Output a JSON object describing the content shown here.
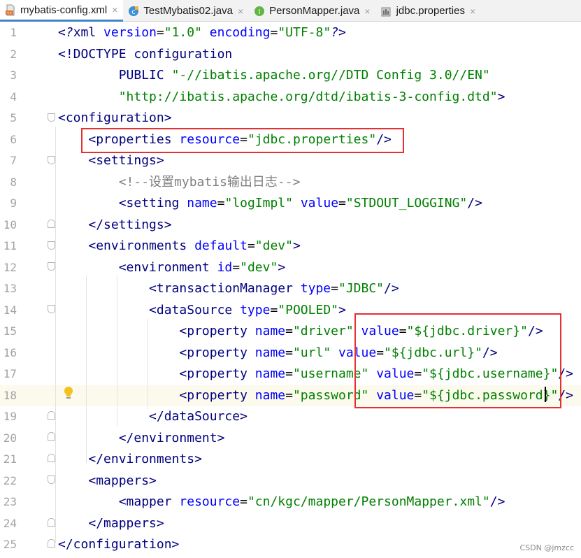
{
  "tabs": [
    {
      "label": "mybatis-config.xml",
      "icon": "xml-file-icon",
      "active": true
    },
    {
      "label": "TestMybatis02.java",
      "icon": "java-class-icon",
      "active": false
    },
    {
      "label": "PersonMapper.java",
      "icon": "java-interface-icon",
      "active": false
    },
    {
      "label": "jdbc.properties",
      "icon": "properties-file-icon",
      "active": false
    }
  ],
  "close_glyph": "×",
  "lines": [
    {
      "n": "1",
      "tokens": [
        [
          "prolog",
          "<?"
        ],
        [
          "tag",
          "xml "
        ],
        [
          "attr",
          "version"
        ],
        [
          "plain",
          "="
        ],
        [
          "str",
          "\"1.0\""
        ],
        [
          "plain",
          " "
        ],
        [
          "attr",
          "encoding"
        ],
        [
          "plain",
          "="
        ],
        [
          "str",
          "\"UTF-8\""
        ],
        [
          "prolog",
          "?>"
        ]
      ]
    },
    {
      "n": "2",
      "tokens": [
        [
          "dt",
          "<!DOCTYPE configuration"
        ]
      ]
    },
    {
      "n": "3",
      "tokens": [
        [
          "plain",
          "        "
        ],
        [
          "dt",
          "PUBLIC "
        ],
        [
          "str",
          "\"-//ibatis.apache.org//DTD Config 3.0//EN\""
        ]
      ]
    },
    {
      "n": "4",
      "tokens": [
        [
          "plain",
          "        "
        ],
        [
          "str",
          "\"http://ibatis.apache.org/dtd/ibatis-3-config.dtd\""
        ],
        [
          "dt",
          ">"
        ]
      ]
    },
    {
      "n": "5",
      "tokens": [
        [
          "tag",
          "<configuration>"
        ]
      ]
    },
    {
      "n": "6",
      "tokens": [
        [
          "plain",
          "    "
        ],
        [
          "tag",
          "<properties "
        ],
        [
          "attr",
          "resource"
        ],
        [
          "plain",
          "="
        ],
        [
          "str",
          "\"jdbc.properties\""
        ],
        [
          "tag",
          "/>"
        ]
      ]
    },
    {
      "n": "7",
      "tokens": [
        [
          "plain",
          "    "
        ],
        [
          "tag",
          "<settings>"
        ]
      ]
    },
    {
      "n": "8",
      "tokens": [
        [
          "plain",
          "        "
        ],
        [
          "cmt",
          "<!--设置mybatis输出日志-->"
        ]
      ]
    },
    {
      "n": "9",
      "tokens": [
        [
          "plain",
          "        "
        ],
        [
          "tag",
          "<setting "
        ],
        [
          "attr",
          "name"
        ],
        [
          "plain",
          "="
        ],
        [
          "str",
          "\"logImpl\""
        ],
        [
          "plain",
          " "
        ],
        [
          "attr",
          "value"
        ],
        [
          "plain",
          "="
        ],
        [
          "str",
          "\"STDOUT_LOGGING\""
        ],
        [
          "tag",
          "/>"
        ]
      ]
    },
    {
      "n": "10",
      "tokens": [
        [
          "plain",
          "    "
        ],
        [
          "tag",
          "</settings>"
        ]
      ]
    },
    {
      "n": "11",
      "tokens": [
        [
          "plain",
          "    "
        ],
        [
          "tag",
          "<environments "
        ],
        [
          "attr",
          "default"
        ],
        [
          "plain",
          "="
        ],
        [
          "str",
          "\"dev\""
        ],
        [
          "tag",
          ">"
        ]
      ]
    },
    {
      "n": "12",
      "tokens": [
        [
          "plain",
          "        "
        ],
        [
          "tag",
          "<environment "
        ],
        [
          "attr",
          "id"
        ],
        [
          "plain",
          "="
        ],
        [
          "str",
          "\"dev\""
        ],
        [
          "tag",
          ">"
        ]
      ]
    },
    {
      "n": "13",
      "tokens": [
        [
          "plain",
          "            "
        ],
        [
          "tag",
          "<transactionManager "
        ],
        [
          "attr",
          "type"
        ],
        [
          "plain",
          "="
        ],
        [
          "str",
          "\"JDBC\""
        ],
        [
          "tag",
          "/>"
        ]
      ]
    },
    {
      "n": "14",
      "tokens": [
        [
          "plain",
          "            "
        ],
        [
          "tag",
          "<dataSource "
        ],
        [
          "attr",
          "type"
        ],
        [
          "plain",
          "="
        ],
        [
          "str",
          "\"POOLED\""
        ],
        [
          "tag",
          ">"
        ]
      ]
    },
    {
      "n": "15",
      "tokens": [
        [
          "plain",
          "                "
        ],
        [
          "tag",
          "<property "
        ],
        [
          "attr",
          "name"
        ],
        [
          "plain",
          "="
        ],
        [
          "str",
          "\"driver\""
        ],
        [
          "plain",
          " "
        ],
        [
          "attr",
          "value"
        ],
        [
          "plain",
          "="
        ],
        [
          "str",
          "\"${jdbc.driver}\""
        ],
        [
          "tag",
          "/>"
        ]
      ]
    },
    {
      "n": "16",
      "tokens": [
        [
          "plain",
          "                "
        ],
        [
          "tag",
          "<property "
        ],
        [
          "attr",
          "name"
        ],
        [
          "plain",
          "="
        ],
        [
          "str",
          "\"url\""
        ],
        [
          "plain",
          " "
        ],
        [
          "attr",
          "value"
        ],
        [
          "plain",
          "="
        ],
        [
          "str",
          "\"${jdbc.url}\""
        ],
        [
          "tag",
          "/>"
        ]
      ]
    },
    {
      "n": "17",
      "tokens": [
        [
          "plain",
          "                "
        ],
        [
          "tag",
          "<property "
        ],
        [
          "attr",
          "name"
        ],
        [
          "plain",
          "="
        ],
        [
          "str",
          "\"username\""
        ],
        [
          "plain",
          " "
        ],
        [
          "attr",
          "value"
        ],
        [
          "plain",
          "="
        ],
        [
          "str",
          "\"${jdbc.username}\""
        ],
        [
          "tag",
          "/>"
        ]
      ]
    },
    {
      "n": "18",
      "tokens": [
        [
          "plain",
          "                "
        ],
        [
          "tag",
          "<property "
        ],
        [
          "attr",
          "name"
        ],
        [
          "plain",
          "="
        ],
        [
          "str",
          "\"password\""
        ],
        [
          "plain",
          " "
        ],
        [
          "attr",
          "value"
        ],
        [
          "plain",
          "="
        ],
        [
          "str",
          "\"${jdbc.password}\""
        ],
        [
          "tag",
          "/>"
        ]
      ]
    },
    {
      "n": "19",
      "tokens": [
        [
          "plain",
          "            "
        ],
        [
          "tag",
          "</dataSource>"
        ]
      ]
    },
    {
      "n": "20",
      "tokens": [
        [
          "plain",
          "        "
        ],
        [
          "tag",
          "</environment>"
        ]
      ]
    },
    {
      "n": "21",
      "tokens": [
        [
          "plain",
          "    "
        ],
        [
          "tag",
          "</environments>"
        ]
      ]
    },
    {
      "n": "22",
      "tokens": [
        [
          "plain",
          "    "
        ],
        [
          "tag",
          "<mappers>"
        ]
      ]
    },
    {
      "n": "23",
      "tokens": [
        [
          "plain",
          "        "
        ],
        [
          "tag",
          "<mapper "
        ],
        [
          "attr",
          "resource"
        ],
        [
          "plain",
          "="
        ],
        [
          "str",
          "\"cn/kgc/mapper/PersonMapper.xml\""
        ],
        [
          "tag",
          "/>"
        ]
      ]
    },
    {
      "n": "24",
      "tokens": [
        [
          "plain",
          "    "
        ],
        [
          "tag",
          "</mappers>"
        ]
      ]
    },
    {
      "n": "25",
      "tokens": [
        [
          "tag",
          "</configuration>"
        ]
      ]
    }
  ],
  "current_line": "18",
  "watermark": "CSDN @jmzcc",
  "colors": {
    "tag": "#000080",
    "attr": "#0000ff",
    "str": "#008000",
    "comment": "#808080",
    "highlight_box": "#e63030",
    "active_tab_underline": "#4083c9"
  }
}
